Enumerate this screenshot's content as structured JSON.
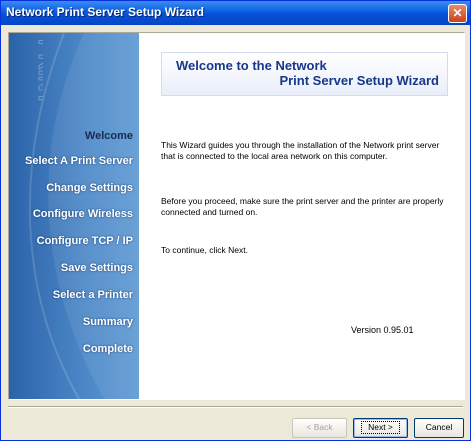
{
  "window": {
    "title": "Network Print Server Setup Wizard",
    "close_glyph": "✕"
  },
  "sidebar": {
    "watermark": "PRINT",
    "steps": [
      {
        "label": "Welcome",
        "active": true
      },
      {
        "label": "Select A Print Server"
      },
      {
        "label": "Change Settings"
      },
      {
        "label": "Configure Wireless"
      },
      {
        "label": "Configure TCP / IP"
      },
      {
        "label": "Save Settings"
      },
      {
        "label": "Select a Printer"
      },
      {
        "label": "Summary"
      },
      {
        "label": "Complete"
      }
    ]
  },
  "banner": {
    "line1": "Welcome to the Network",
    "line2": "Print Server Setup Wizard"
  },
  "body": {
    "para1": "This Wizard guides you through the installation of the Network print server that is connected to the local area network on this computer.",
    "para2": "Before you proceed, make sure the print server and the printer are properly connected and turned on.",
    "para3": "To continue, click Next."
  },
  "version": "Version 0.95.01",
  "buttons": {
    "back": "< Back",
    "next": "Next >",
    "cancel": "Cancel"
  }
}
